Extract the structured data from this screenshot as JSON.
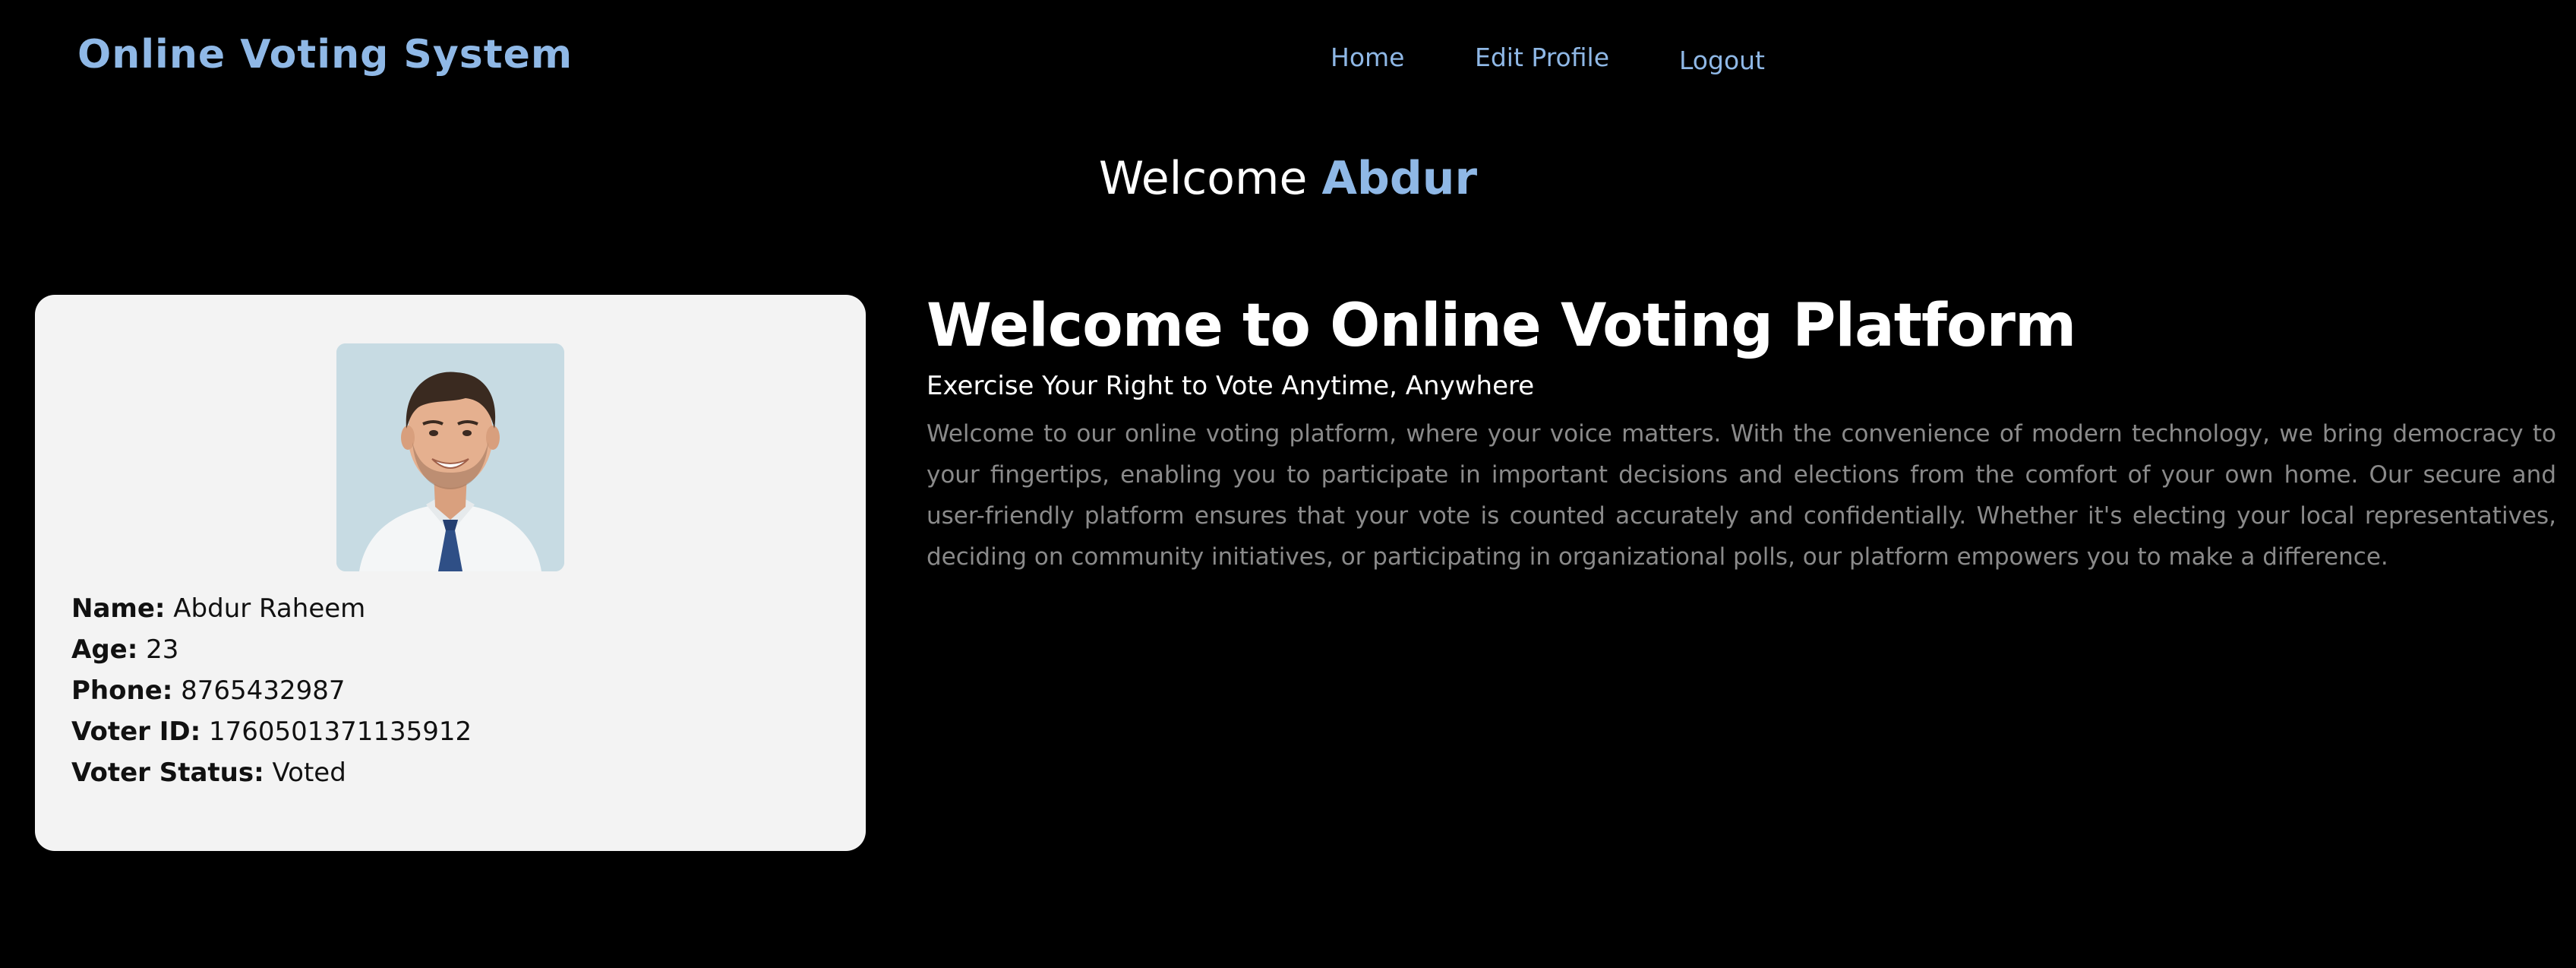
{
  "navbar": {
    "brand": "Online Voting System",
    "links": [
      "Home",
      "Edit Profile",
      "Logout"
    ]
  },
  "greeting": {
    "prefix": "Welcome",
    "name": "Abdur"
  },
  "profile": {
    "avatar": "user-photo",
    "fields": [
      {
        "label": "Name:",
        "value": "Abdur Raheem"
      },
      {
        "label": "Age:",
        "value": "23"
      },
      {
        "label": "Phone:",
        "value": "8765432987"
      },
      {
        "label": "Voter ID:",
        "value": "1760501371135912"
      },
      {
        "label": "Voter Status:",
        "value": "Voted"
      }
    ]
  },
  "main": {
    "title": "Welcome to Online Voting Platform",
    "subtitle": "Exercise Your Right to Vote Anytime, Anywhere",
    "body": "Welcome to our online voting platform, where your voice matters. With the convenience of modern technology, we bring democracy to your fingertips, enabling you to participate in important decisions and elections from the comfort of your own home. Our secure and user-friendly platform ensures that your vote is counted accurately and confidentially. Whether it's electing your local representatives, deciding on community initiatives, or participating in organizational polls, our platform empowers you to make a difference."
  },
  "colors": {
    "background": "#000000",
    "accent": "#8fb8e6",
    "card": "#f3f3f3",
    "body_text": "#8a8a8a"
  }
}
